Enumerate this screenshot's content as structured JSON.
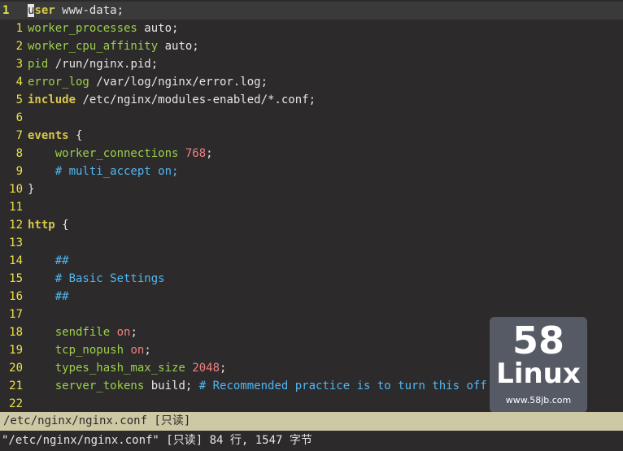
{
  "editor": {
    "lines": [
      {
        "number": "1",
        "current": true,
        "segments": [
          {
            "t": "u",
            "c": "cursor"
          },
          {
            "t": "ser",
            "c": "kw"
          },
          {
            "t": " www-data;",
            "c": ""
          }
        ]
      },
      {
        "number": "1",
        "segments": [
          {
            "t": "worker_processes",
            "c": "dir"
          },
          {
            "t": " auto;",
            "c": ""
          }
        ]
      },
      {
        "number": "2",
        "segments": [
          {
            "t": "worker_cpu_affinity",
            "c": "dir"
          },
          {
            "t": " auto;",
            "c": ""
          }
        ]
      },
      {
        "number": "3",
        "segments": [
          {
            "t": "pid",
            "c": "dir"
          },
          {
            "t": " /run/nginx.pid;",
            "c": ""
          }
        ]
      },
      {
        "number": "4",
        "segments": [
          {
            "t": "error_log",
            "c": "dir"
          },
          {
            "t": " /var/log/nginx/error.log;",
            "c": ""
          }
        ]
      },
      {
        "number": "5",
        "segments": [
          {
            "t": "include",
            "c": "kw"
          },
          {
            "t": " /etc/nginx/modules-enabled/*.conf;",
            "c": ""
          }
        ]
      },
      {
        "number": "6",
        "segments": []
      },
      {
        "number": "7",
        "segments": [
          {
            "t": "events",
            "c": "kw"
          },
          {
            "t": " {",
            "c": ""
          }
        ]
      },
      {
        "number": "8",
        "segments": [
          {
            "t": "    ",
            "c": ""
          },
          {
            "t": "worker_connections",
            "c": "dir"
          },
          {
            "t": " ",
            "c": ""
          },
          {
            "t": "768",
            "c": "num"
          },
          {
            "t": ";",
            "c": ""
          }
        ]
      },
      {
        "number": "9",
        "segments": [
          {
            "t": "    ",
            "c": ""
          },
          {
            "t": "# multi_accept on;",
            "c": "cmt"
          }
        ]
      },
      {
        "number": "10",
        "segments": [
          {
            "t": "}",
            "c": ""
          }
        ]
      },
      {
        "number": "11",
        "segments": []
      },
      {
        "number": "12",
        "segments": [
          {
            "t": "http",
            "c": "kw"
          },
          {
            "t": " {",
            "c": ""
          }
        ]
      },
      {
        "number": "13",
        "segments": []
      },
      {
        "number": "14",
        "segments": [
          {
            "t": "    ",
            "c": ""
          },
          {
            "t": "##",
            "c": "cmt"
          }
        ]
      },
      {
        "number": "15",
        "segments": [
          {
            "t": "    ",
            "c": ""
          },
          {
            "t": "# Basic Settings",
            "c": "cmt"
          }
        ]
      },
      {
        "number": "16",
        "segments": [
          {
            "t": "    ",
            "c": ""
          },
          {
            "t": "##",
            "c": "cmt"
          }
        ]
      },
      {
        "number": "17",
        "segments": []
      },
      {
        "number": "18",
        "segments": [
          {
            "t": "    ",
            "c": ""
          },
          {
            "t": "sendfile",
            "c": "dir"
          },
          {
            "t": " ",
            "c": ""
          },
          {
            "t": "on",
            "c": "num"
          },
          {
            "t": ";",
            "c": ""
          }
        ]
      },
      {
        "number": "19",
        "segments": [
          {
            "t": "    ",
            "c": ""
          },
          {
            "t": "tcp_nopush",
            "c": "dir"
          },
          {
            "t": " ",
            "c": ""
          },
          {
            "t": "on",
            "c": "num"
          },
          {
            "t": ";",
            "c": ""
          }
        ]
      },
      {
        "number": "20",
        "segments": [
          {
            "t": "    ",
            "c": ""
          },
          {
            "t": "types_hash_max_size",
            "c": "dir"
          },
          {
            "t": " ",
            "c": ""
          },
          {
            "t": "2048",
            "c": "num"
          },
          {
            "t": ";",
            "c": ""
          }
        ]
      },
      {
        "number": "21",
        "segments": [
          {
            "t": "    ",
            "c": ""
          },
          {
            "t": "server_tokens",
            "c": "dir"
          },
          {
            "t": " build; ",
            "c": ""
          },
          {
            "t": "# Recommended practice is to turn this off",
            "c": "cmt"
          }
        ]
      },
      {
        "number": "22",
        "segments": []
      }
    ]
  },
  "watermark": {
    "number": "58",
    "name": "Linux",
    "site": "www.58jb.com"
  },
  "statusline": {
    "text": "/etc/nginx/nginx.conf [只读]"
  },
  "cmdline": {
    "text": "\"/etc/nginx/nginx.conf\" [只读] 84 行, 1547 字节"
  },
  "colors": {
    "background": "#2d2a2c",
    "line_number": "#e8e24a",
    "keyword": "#d8c84a",
    "directive": "#9ad04a",
    "number": "#f08080",
    "comment": "#4fb7f0",
    "statusline_bg": "#ccc9a4"
  }
}
